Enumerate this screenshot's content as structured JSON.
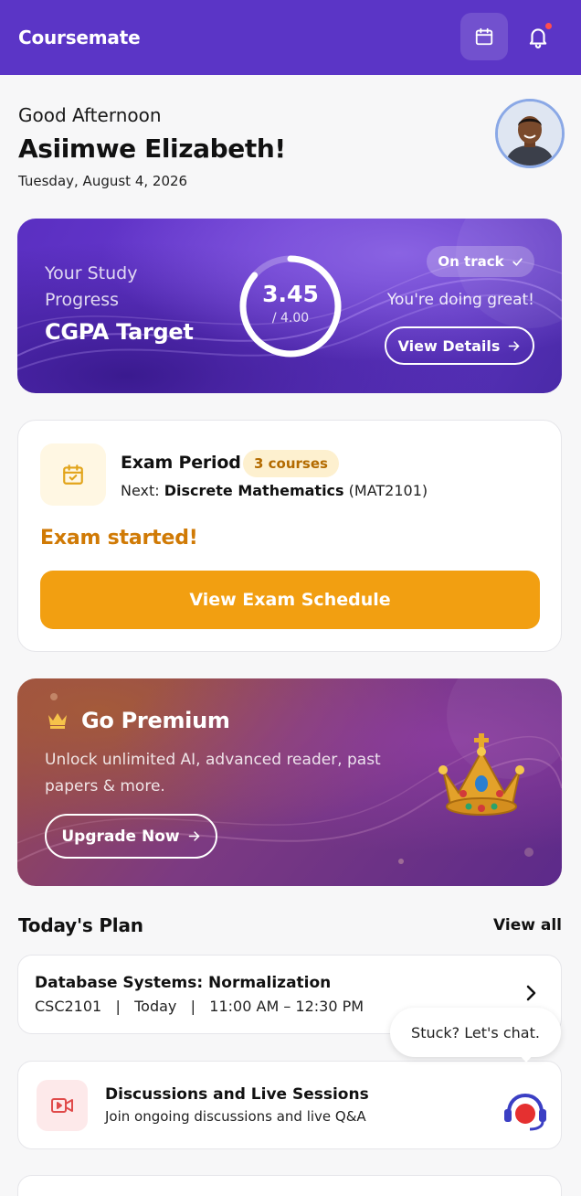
{
  "app": {
    "title": "Coursemate"
  },
  "header": {
    "calendar_icon": "calendar-icon",
    "bell_icon": "bell-icon",
    "has_notification": true
  },
  "greeting": {
    "salutation": "Good Afternoon",
    "name": "Asiimwe Elizabeth!",
    "date": "Tuesday, August 4, 2026"
  },
  "progress": {
    "label": "Your Study Progress",
    "target_label": "CGPA Target",
    "cgpa": "3.45",
    "max": "/ 4.00",
    "status": "On track",
    "message": "You're doing great!",
    "details_button": "View Details",
    "ring_fraction": 0.8625
  },
  "exam": {
    "title": "Exam Period",
    "count": "3 courses",
    "next_prefix": "Next: ",
    "next_course": "Discrete Mathematics",
    "next_code": " (MAT2101)",
    "status": "Exam started!",
    "button": "View Exam Schedule"
  },
  "premium": {
    "title": "Go Premium",
    "description": "Unlock unlimited AI, advanced reader, past papers & more.",
    "button": "Upgrade Now"
  },
  "plan": {
    "title": "Today's Plan",
    "view_all": "View all",
    "items": [
      {
        "name": "Database Systems: Normalization",
        "meta": "CSC2101   |   Today   |   11:00 AM – 12:30 PM"
      }
    ]
  },
  "chat": {
    "bubble": "Stuck? Let's chat."
  },
  "discussions": {
    "title": "Discussions and Live Sessions",
    "subtitle": "Join ongoing discussions and live Q&A"
  },
  "colors": {
    "brand": "#5b35c6",
    "accent": "#f29f11",
    "warning_text": "#d07a05"
  }
}
